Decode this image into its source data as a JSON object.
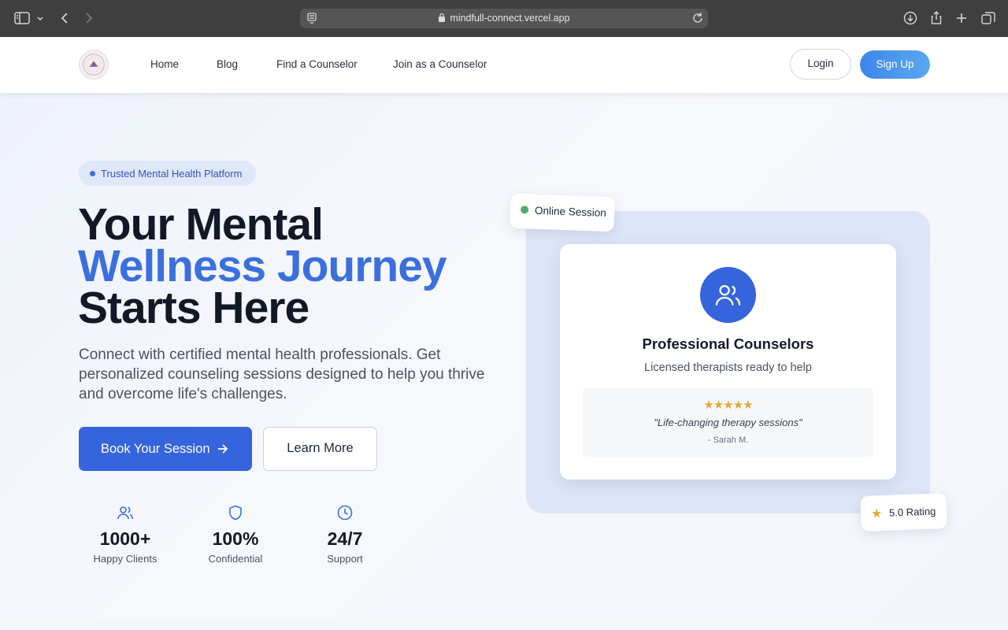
{
  "browser": {
    "url": "mindfull-connect.vercel.app"
  },
  "nav": {
    "links": [
      "Home",
      "Blog",
      "Find a Counselor",
      "Join as a Counselor"
    ],
    "login_label": "Login",
    "signup_label": "Sign Up"
  },
  "hero": {
    "badge": "Trusted Mental Health Platform",
    "title_line1": "Your Mental",
    "title_line2": "Wellness Journey",
    "title_line3": "Starts Here",
    "description": "Connect with certified mental health professionals. Get personalized counseling sessions designed to help you thrive and overcome life's challenges.",
    "primary_cta": "Book Your Session",
    "secondary_cta": "Learn More",
    "stats": [
      {
        "value": "1000+",
        "label": "Happy Clients",
        "icon": "users-icon"
      },
      {
        "value": "100%",
        "label": "Confidential",
        "icon": "shield-icon"
      },
      {
        "value": "24/7",
        "label": "Support",
        "icon": "clock-icon"
      }
    ]
  },
  "visual": {
    "online_chip": "Online Session",
    "card_title": "Professional Counselors",
    "card_subtitle": "Licensed therapists ready to help",
    "stars": "★★★★★",
    "quote": "\"Life-changing therapy sessions\"",
    "author": "- Sarah M.",
    "rating_chip": "5.0 Rating"
  },
  "colors": {
    "accent": "#3564dd",
    "heading_blue": "#3b6fdc",
    "star": "#e1a93a",
    "online_green": "#4caf6a"
  }
}
